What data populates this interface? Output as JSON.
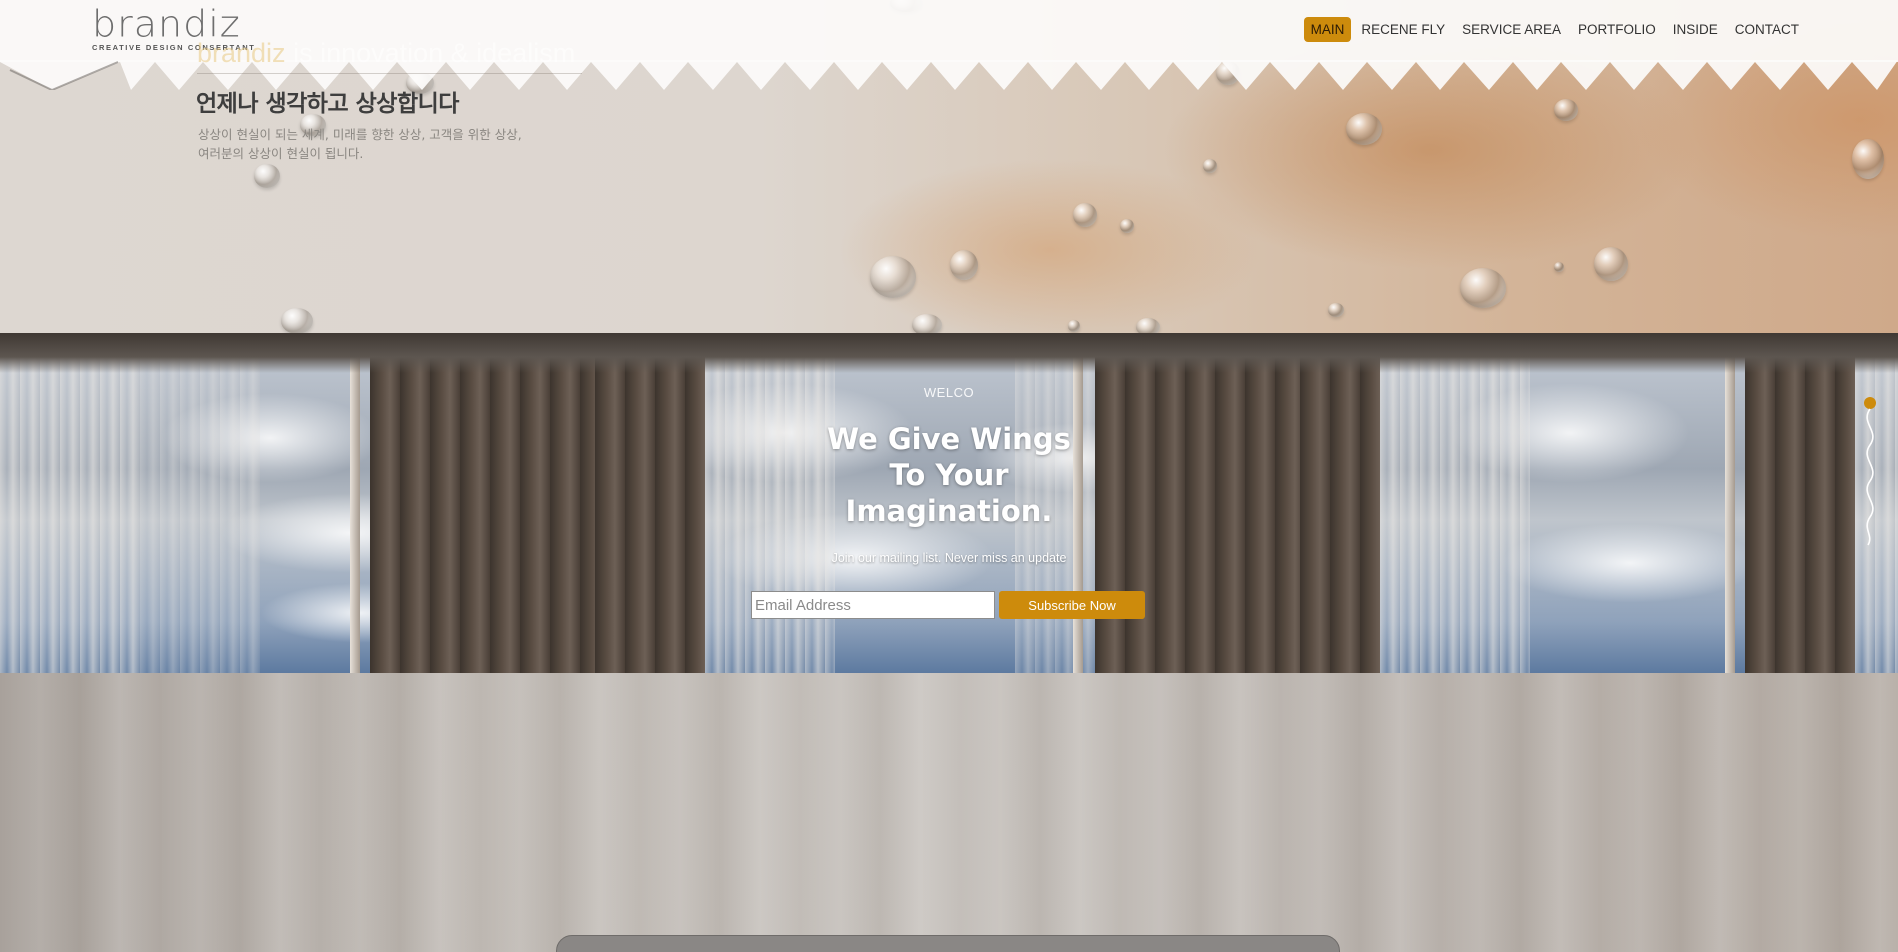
{
  "header": {
    "logo_word": "brandiz",
    "logo_tagline": "CREATIVE DESIGN CONSERTANT",
    "nav": [
      {
        "label": "MAIN",
        "active": true
      },
      {
        "label": "RECENE FLY",
        "active": false
      },
      {
        "label": "SERVICE AREA",
        "active": false
      },
      {
        "label": "PORTFOLIO",
        "active": false
      },
      {
        "label": "INSIDE",
        "active": false
      },
      {
        "label": "CONTACT",
        "active": false
      }
    ]
  },
  "hero": {
    "tagline_brand": "brandiz",
    "tagline_rest": " is innovation & idealism",
    "title": "언제나 생각하고 상상합니다",
    "desc_line1": "상상이 현실이 되는 세계, 미래를 향한 상상, 고객을 위한 상상,",
    "desc_line2": "여러분의 상상이 현실이 됩니다."
  },
  "welcome": {
    "label": "WELCO",
    "heading_line1": "We Give Wings",
    "heading_line2": "To Your",
    "heading_line3": "Imagination.",
    "subtitle": "Join our mailing list. Never miss an update",
    "email_placeholder": "Email Address",
    "subscribe_label": "Subscribe Now"
  },
  "colors": {
    "accent": "#cd8b0c",
    "nav_text": "#333333",
    "header_bg": "#fcfbfa"
  }
}
